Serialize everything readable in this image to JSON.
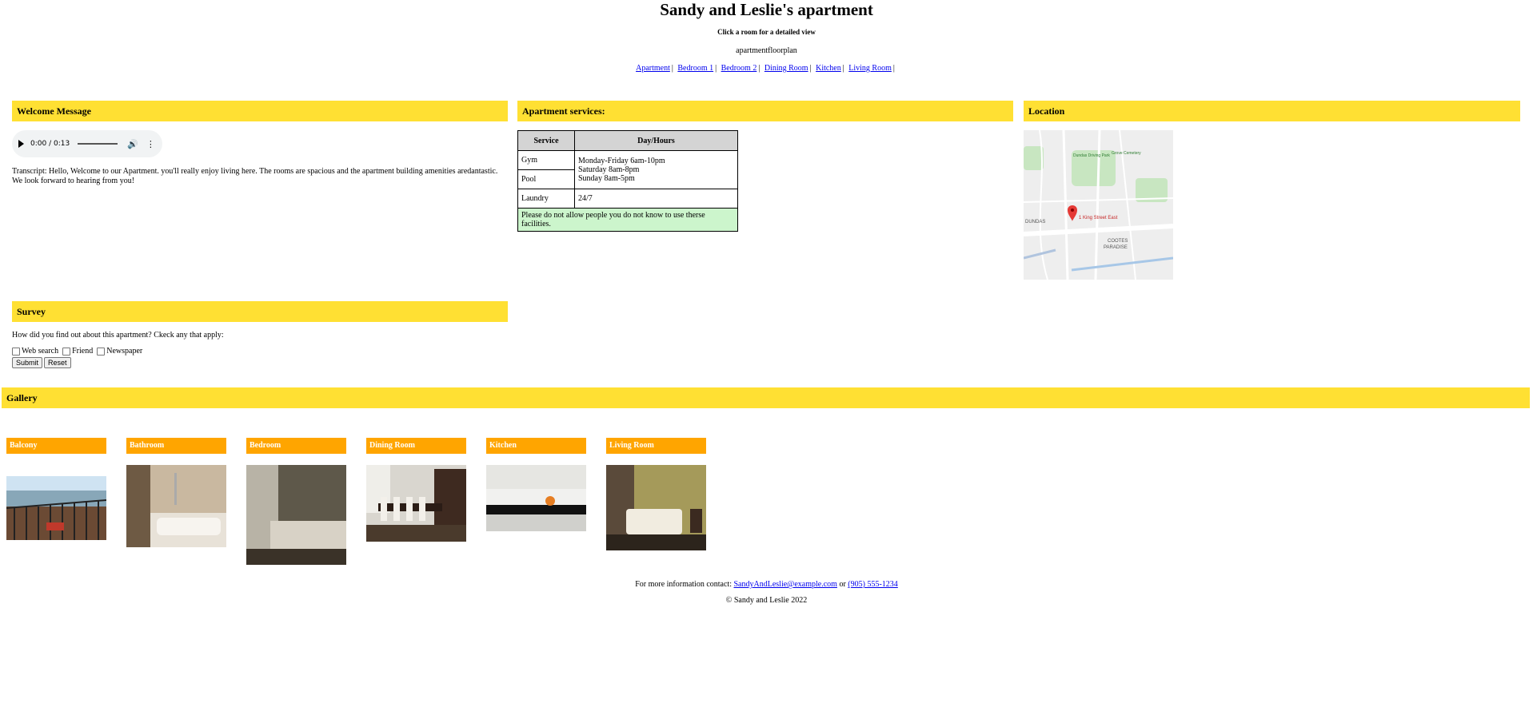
{
  "header": {
    "title": "Sandy and Leslie's apartment",
    "subtitle": "Click a room for a detailed view",
    "floorplan_alt": "apartmentfloorplan"
  },
  "room_nav": {
    "items": [
      "Apartment",
      "Bedroom 1",
      "Bedroom 2",
      "Dining Room",
      "Kitchen",
      "Living Room"
    ],
    "separator": "|"
  },
  "welcome": {
    "heading": "Welcome Message",
    "audio_time": "0:00 / 0:13",
    "transcript": "Transcript: Hello, Welcome to our Apartment. you'll really enjoy living here. The rooms are spacious and the apartment building amenities aredantastic. We look forward to hearing from you!"
  },
  "services": {
    "heading": "Apartment services:",
    "col_service": "Service",
    "col_hours": "Day/Hours",
    "gym": "Gym",
    "pool": "Pool",
    "hours_line1": "Monday-Friday 6am-10pm",
    "hours_line2": "Saturday 8am-8pm",
    "hours_line3": "Sunday 8am-5pm",
    "laundry": "Laundry",
    "laundry_hours": "24/7",
    "note": "Please do not allow people you do not know to use therse facilities."
  },
  "location": {
    "heading": "Location",
    "map_labels": {
      "pin": "1 King Street East",
      "area1": "DUNDAS",
      "area2": "COOTES",
      "area3": "PARADISE",
      "park": "Dundas Driving Park",
      "cemetery": "Grove Cemetery"
    }
  },
  "survey": {
    "heading": "Survey",
    "question": "How did you find out about this apartment? Ckeck any that apply:",
    "options": [
      "Web search",
      "Friend",
      "Newspaper"
    ],
    "submit": "Submit",
    "reset": "Reset"
  },
  "gallery": {
    "heading": "Gallery",
    "items": [
      "Balcony",
      "Bathroom",
      "Bedroom",
      "Dining Room",
      "Kitchen",
      "Living Room"
    ]
  },
  "footer": {
    "contact_prefix": "For more information contact:",
    "email": "SandyAndLeslie@example.com",
    "or": "or",
    "phone": "(905) 555-1234",
    "copyright": "© Sandy and Leslie 2022"
  },
  "colors": {
    "section_header": "#ffe033",
    "gallery_label": "#ffa500",
    "table_note": "#ccf5cc",
    "link": "#0000ee"
  }
}
